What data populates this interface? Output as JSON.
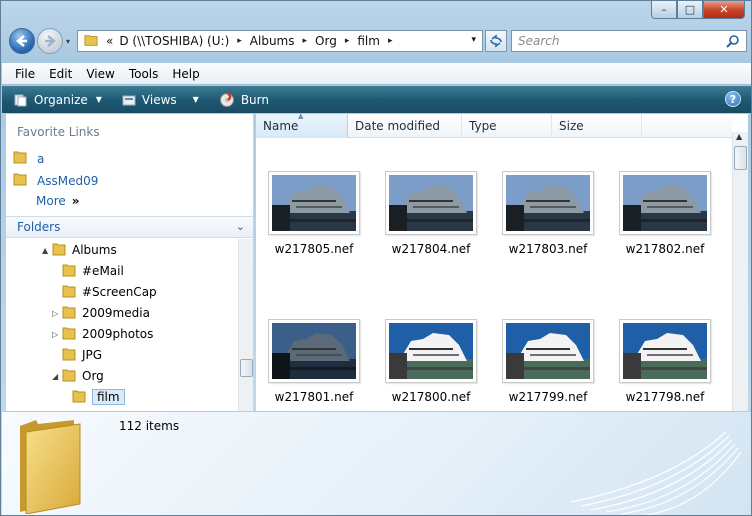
{
  "window": {
    "caption": {
      "minimize": "–",
      "maximize": "□",
      "close": "✕"
    }
  },
  "nav": {
    "back_icon": "back-arrow-icon",
    "forward_icon": "forward-arrow-icon",
    "history_arrow": "▾",
    "address": {
      "overflow": "«",
      "crumbs": [
        "D (\\\\TOSHIBA) (U:)",
        "Albums",
        "Org",
        "film"
      ],
      "separator": "▸",
      "dropdown": "▾"
    },
    "refresh_icon": "refresh-icon",
    "search": {
      "placeholder": "Search"
    }
  },
  "menubar": {
    "items": [
      "File",
      "Edit",
      "View",
      "Tools",
      "Help"
    ]
  },
  "commandbar": {
    "organize": "Organize",
    "views": "Views",
    "burn": "Burn",
    "help": "?"
  },
  "leftpane": {
    "favorite_links_title": "Favorite Links",
    "favorites": [
      "a",
      "AssMed09"
    ],
    "more": "More",
    "more_chevron": "»",
    "folders_title": "Folders",
    "tree": [
      {
        "label": "Albums",
        "level": 0,
        "expander": "▲",
        "selected": false
      },
      {
        "label": "#eMail",
        "level": 1,
        "expander": "",
        "selected": false
      },
      {
        "label": "#ScreenCap",
        "level": 1,
        "expander": "",
        "selected": false
      },
      {
        "label": "2009media",
        "level": 1,
        "expander": "▷",
        "selected": false
      },
      {
        "label": "2009photos",
        "level": 1,
        "expander": "▷",
        "selected": false
      },
      {
        "label": "JPG",
        "level": 1,
        "expander": "",
        "selected": false
      },
      {
        "label": "Org",
        "level": 1,
        "expander": "◢",
        "selected": false
      },
      {
        "label": "film",
        "level": 2,
        "expander": "",
        "selected": true
      }
    ]
  },
  "columns": [
    "Name",
    "Date modified",
    "Type",
    "Size"
  ],
  "files": [
    {
      "name": "w217805.nef",
      "style": "dark"
    },
    {
      "name": "w217804.nef",
      "style": "dark"
    },
    {
      "name": "w217803.nef",
      "style": "dark"
    },
    {
      "name": "w217802.nef",
      "style": "dark"
    },
    {
      "name": "w217801.nef",
      "style": "dusk"
    },
    {
      "name": "w217800.nef",
      "style": "bright"
    },
    {
      "name": "w217799.nef",
      "style": "bright"
    },
    {
      "name": "w217798.nef",
      "style": "bright"
    }
  ],
  "details": {
    "item_count": "112 items"
  },
  "colors": {
    "folder": "#e9c14f",
    "link": "#1e5fa8",
    "commandbar": "#1f5a74"
  }
}
